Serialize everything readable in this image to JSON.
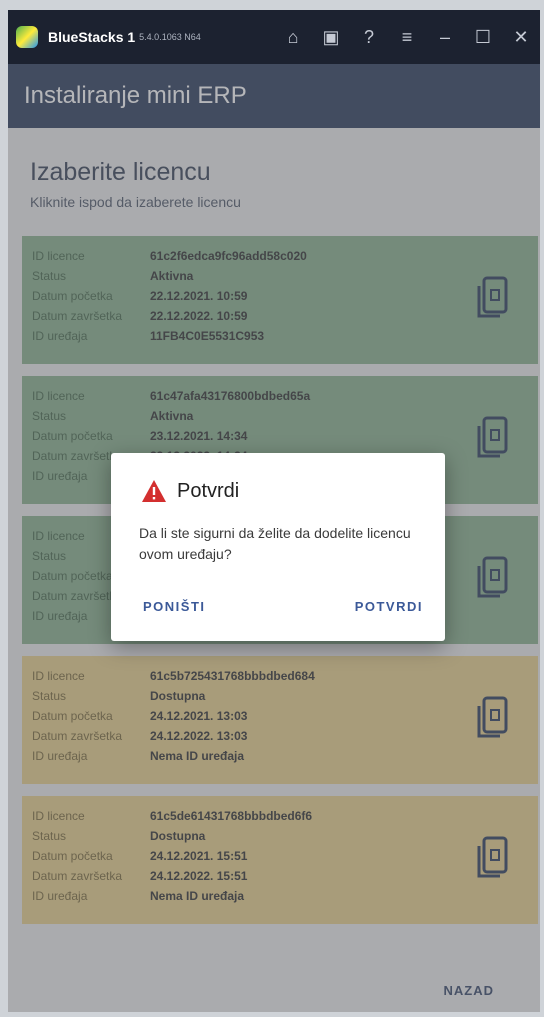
{
  "window": {
    "app_name": "BlueStacks 1",
    "version": "5.4.0.1063 N64",
    "icons": [
      "home-icon",
      "windows-icon",
      "help-icon",
      "menu-icon",
      "minimize-icon",
      "maximize-icon",
      "close-icon"
    ],
    "icon_glyphs": [
      "⌂",
      "▣",
      "?",
      "≡",
      "–",
      "☐",
      "✕"
    ]
  },
  "header": {
    "title": "Instaliranje mini ERP"
  },
  "page": {
    "title": "Izaberite licencu",
    "subtitle": "Kliknite ispod da izaberete licencu"
  },
  "labels": {
    "id": "ID licence",
    "status": "Status",
    "start": "Datum početka",
    "end": "Datum završetka",
    "device": "ID uređaja"
  },
  "licenses": [
    {
      "id": "61c2f6edca9fc96add58c020",
      "status": "Aktivna",
      "start": "22.12.2021. 10:59",
      "end": "22.12.2022. 10:59",
      "device": "11FB4C0E5531C953",
      "state": "active"
    },
    {
      "id": "61c47afa43176800bdbed65a",
      "status": "Aktivna",
      "start": "23.12.2021. 14:34",
      "end": "23.12.2022. 14:34",
      "device": "",
      "state": "active"
    },
    {
      "id": "",
      "status": "",
      "start": "",
      "end": "",
      "device": "",
      "state": "active"
    },
    {
      "id": "61c5b725431768bbbdbed684",
      "status": "Dostupna",
      "start": "24.12.2021. 13:03",
      "end": "24.12.2022. 13:03",
      "device": "Nema ID uređaja",
      "state": "free"
    },
    {
      "id": "61c5de61431768bbbdbed6f6",
      "status": "Dostupna",
      "start": "24.12.2021. 15:51",
      "end": "24.12.2022. 15:51",
      "device": "Nema ID uređaja",
      "state": "free"
    }
  ],
  "footer": {
    "back_label": "NAZAD"
  },
  "dialog": {
    "title": "Potvrdi",
    "message": "Da li ste sigurni da želite da dodelite licencu ovom uređaju?",
    "cancel_label": "PONIŠTI",
    "confirm_label": "POTVRDI"
  },
  "colors": {
    "header": "#2f3e5e",
    "active_card": "#8ab18f",
    "free_card": "#e8d08c",
    "warning": "#d32f2f",
    "dialog_button": "#3b5998"
  }
}
